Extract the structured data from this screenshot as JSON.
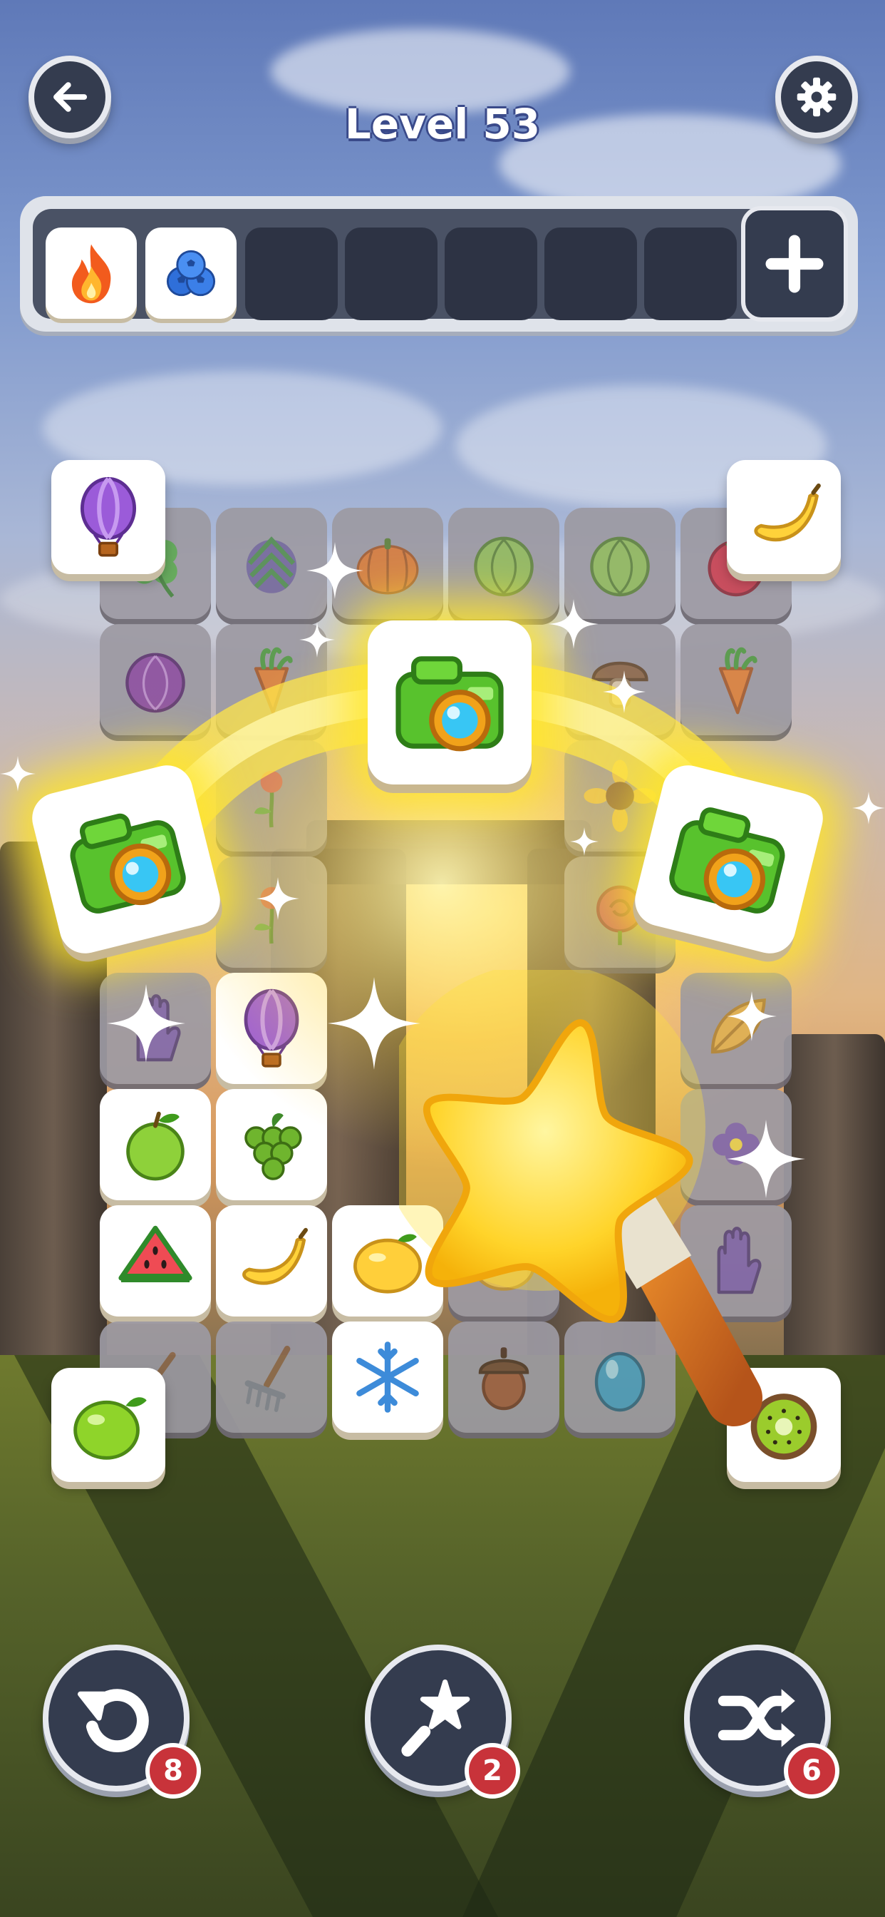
{
  "header": {
    "level_title": "Level 53",
    "back_icon": "arrow-left-icon",
    "settings_icon": "gear-icon"
  },
  "tray": {
    "slots_total": 7,
    "filled": [
      {
        "icon": "fire-icon"
      },
      {
        "icon": "blueberries-icon"
      }
    ],
    "add_slot_icon": "plus-icon"
  },
  "board": {
    "rows": [
      [
        "clover-icon",
        "artichoke-icon",
        "pumpkin-icon",
        "cabbage-icon",
        "lettuce-icon",
        "tomato-icon"
      ],
      [
        "red-cabbage-icon",
        "carrot-icon",
        "",
        "",
        "mushroom-icon",
        "carrot-icon"
      ],
      [
        "",
        "flower-sprig-icon",
        "",
        "",
        "sunflower-icon",
        ""
      ],
      [
        "",
        "flower-sprig-icon",
        "",
        "",
        "rose-icon",
        ""
      ],
      [
        "glove-icon",
        "hot-air-balloon-icon",
        "",
        "",
        "",
        "leaf-icon"
      ],
      [
        "green-apple-icon",
        "grapes-icon",
        "",
        "",
        "",
        "violet-flower-icon"
      ],
      [
        "watermelon-icon",
        "banana-icon",
        "lemon-icon",
        "lemon-icon",
        "",
        "glove-icon"
      ],
      [
        "shovel-icon",
        "rake-icon",
        "snowflake-icon",
        "acorn-icon",
        "egg-icon",
        ""
      ]
    ],
    "corner_tiles": [
      {
        "icon": "hot-air-balloon-icon"
      },
      {
        "icon": "banana-icon"
      },
      {
        "icon": "lime-icon"
      },
      {
        "icon": "kiwi-icon"
      }
    ],
    "highlighted_match": [
      "camera-icon",
      "camera-icon",
      "camera-icon"
    ],
    "magic_wand_effect": "star-wand-icon"
  },
  "boosters": [
    {
      "name": "undo",
      "icon": "undo-icon",
      "count": "8"
    },
    {
      "name": "magic-wand",
      "icon": "magic-wand-icon",
      "count": "2"
    },
    {
      "name": "shuffle",
      "icon": "shuffle-icon",
      "count": "6"
    }
  ],
  "colors": {
    "button_dark": "#343c4f",
    "badge_red": "#c8333a",
    "glow_yellow": "#ffe23a",
    "tile_white": "#ffffff"
  }
}
